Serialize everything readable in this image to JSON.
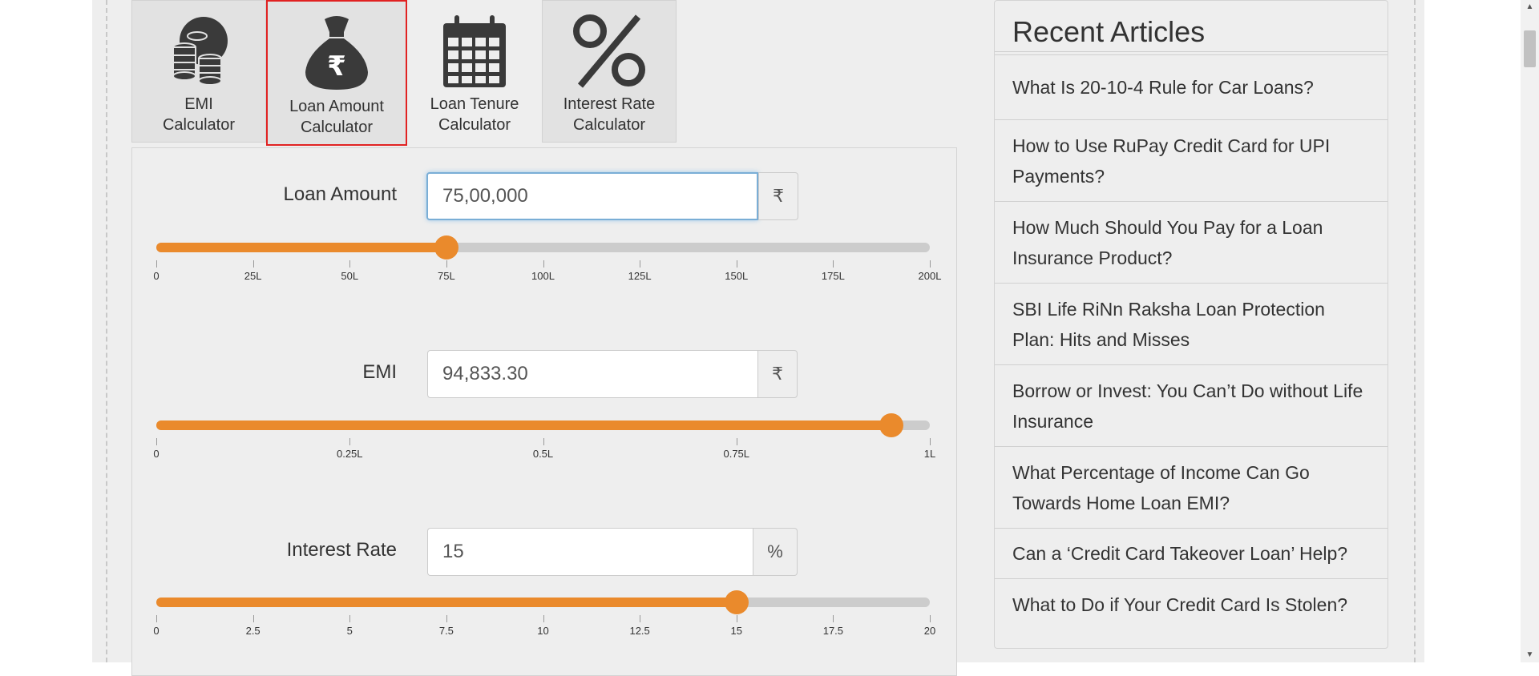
{
  "tabs": [
    {
      "label": "EMI\nCalculator",
      "icon": "coins-icon"
    },
    {
      "label": "Loan Amount\nCalculator",
      "icon": "money-bag-rupee-icon",
      "active": true
    },
    {
      "label": "Loan Tenure\nCalculator",
      "icon": "calendar-icon"
    },
    {
      "label": "Interest Rate\nCalculator",
      "icon": "percent-icon"
    }
  ],
  "calculator": {
    "loan_amount": {
      "label": "Loan Amount",
      "value": "75,00,000",
      "unit": "₹",
      "slider_value": 75,
      "slider_max": 200,
      "ticks": [
        "0",
        "25L",
        "50L",
        "75L",
        "100L",
        "125L",
        "150L",
        "175L",
        "200L"
      ]
    },
    "emi": {
      "label": "EMI",
      "value": "94,833.30",
      "unit": "₹",
      "slider_value": 0.95,
      "slider_max": 1,
      "ticks": [
        "0",
        "0.25L",
        "0.5L",
        "0.75L",
        "1L"
      ]
    },
    "interest_rate": {
      "label": "Interest Rate",
      "value": "15",
      "unit": "%",
      "slider_value": 15,
      "slider_max": 20,
      "ticks": [
        "0",
        "2.5",
        "5",
        "7.5",
        "10",
        "12.5",
        "15",
        "17.5",
        "20"
      ]
    }
  },
  "sidebar": {
    "title": "Recent Articles",
    "articles": [
      "What Is 20-10-4 Rule for Car Loans?",
      "How to Use RuPay Credit Card for UPI Payments?",
      "How Much Should You Pay for a Loan Insurance Product?",
      "SBI Life RiNn Raksha Loan Protection Plan: Hits and Misses",
      "Borrow or Invest: You Can’t Do without Life Insurance",
      "What Percentage of Income Can Go Towards Home Loan EMI?",
      "Can a ‘Credit Card Takeover Loan’ Help?",
      "What to Do if Your Credit Card Is Stolen?"
    ]
  },
  "colors": {
    "accent": "#ea8a2c",
    "track": "#cccccc",
    "active_tab_border": "#e12222"
  }
}
